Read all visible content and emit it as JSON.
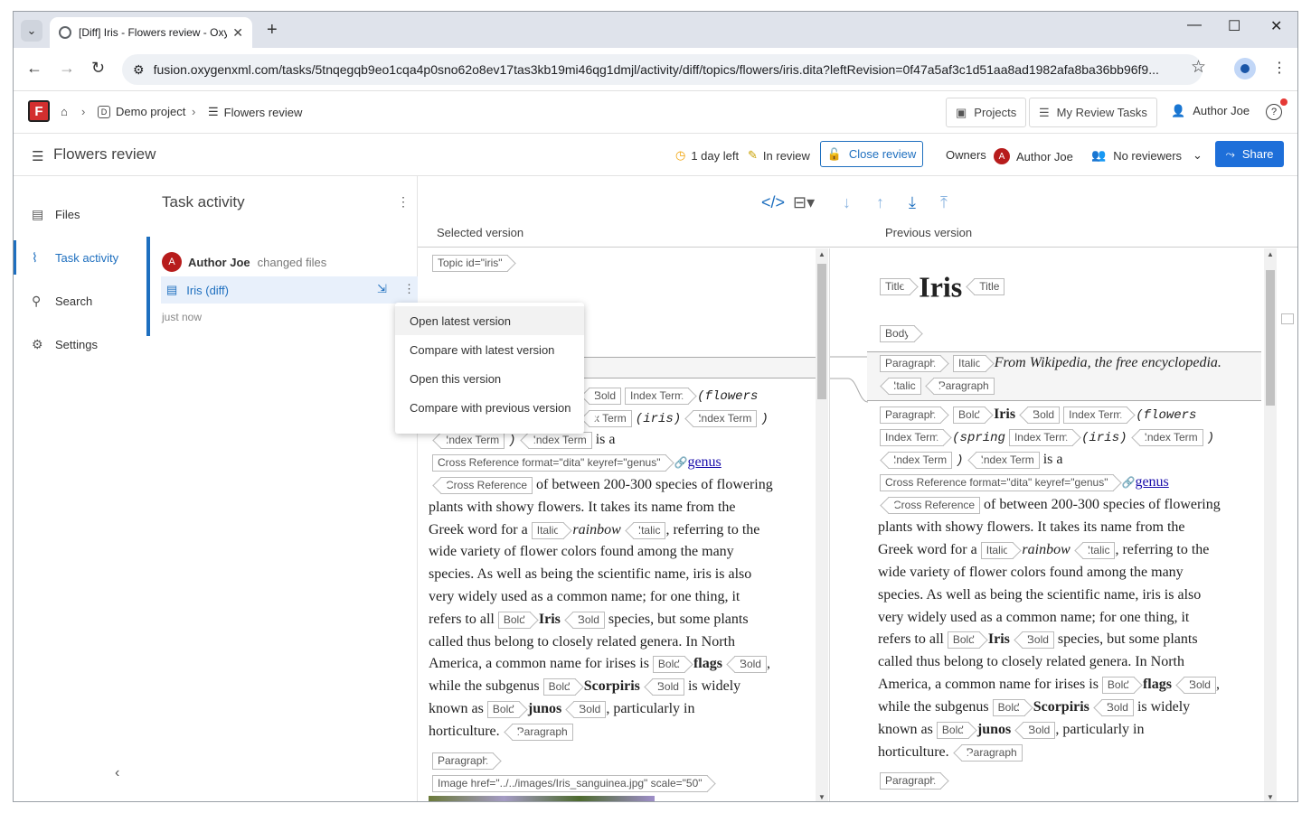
{
  "browser": {
    "tab_title": "[Diff] Iris - Flowers review - Oxygen",
    "url": "fusion.oxygenxml.com/tasks/5tnqegqb9eo1cqa4p0sno62o8ev17tas3kb19mi46qg1dmjl/activity/diff/topics/flowers/iris.dita?leftRevision=0f47a5af3c1d51aa8ad1982afa8ba36bb96f9..."
  },
  "app": {
    "breadcrumb": {
      "project": "Demo project",
      "review": "Flowers review"
    },
    "projects_label": "Projects",
    "my_review_tasks_label": "My Review Tasks",
    "user": "Author Joe"
  },
  "review": {
    "title": "Flowers review",
    "time_left": "1 day left",
    "status": "In review",
    "close_label": "Close review",
    "owners_label": "Owners",
    "owner_initial": "A",
    "owner_name": "Author Joe",
    "reviewers": "No reviewers",
    "share_label": "Share"
  },
  "sidebar": {
    "items": [
      {
        "label": "Files",
        "icon": "file-icon"
      },
      {
        "label": "Task activity",
        "icon": "activity-icon"
      },
      {
        "label": "Search",
        "icon": "search-icon"
      },
      {
        "label": "Settings",
        "icon": "gear-icon"
      }
    ]
  },
  "activity": {
    "header": "Task activity",
    "author_initial": "A",
    "author": "Author Joe",
    "action": "changed files",
    "file": "Iris (diff)",
    "time": "just now"
  },
  "context_menu": [
    "Open latest version",
    "Compare with latest version",
    "Open this version",
    "Compare with previous version"
  ],
  "diff": {
    "selected_label": "Selected version",
    "previous_label": "Previous version",
    "tags": {
      "topic": "Topic id=\"iris\"",
      "title": "Title",
      "body": "Body",
      "paragraph": "Paragraph",
      "italic": "Italic",
      "bold": "Bold",
      "index_term": "Index Term",
      "xref": "Cross Reference format=\"dita\" keyref=\"genus\"",
      "xref_close": "Cross Reference",
      "image": "Image href=\"../../images/Iris_sanguinea.jpg\" scale=\"50\"",
      "index_term_partial": "x Term"
    },
    "text": {
      "iris_title": "Iris",
      "wiki": "From Wikipedia, the free encyclopedia.",
      "flowers": "(flowers",
      "spring": "(spring",
      "iris_paren": "(iris)",
      "close_paren": ")",
      "is_a": "is a",
      "genus": "genus",
      "iris_bold": "Iris",
      "l1": "of between 200-300 species of flowering",
      "l2": "plants with showy flowers. It takes its name from the",
      "l3": "Greek word for a",
      "rainbow": "rainbow",
      "l3b": ", referring to the",
      "l4": "wide variety of flower colors found among the many",
      "l5": "species. As well as being the scientific name, iris is also",
      "l6": "very widely used as a common name; for one thing, it",
      "l7": "refers to all",
      "l7b": "species, but some plants",
      "l8": "called thus belong to closely related genera. In North",
      "l9": "America, a common name for irises is",
      "flags": "flags",
      "comma": ",",
      "l10": "while the subgenus",
      "scorpiris": "Scorpiris",
      "l10b": "is widely",
      "l11": "known as",
      "junos": "junos",
      "l11b": ", particularly in",
      "l12": "horticulture."
    }
  }
}
